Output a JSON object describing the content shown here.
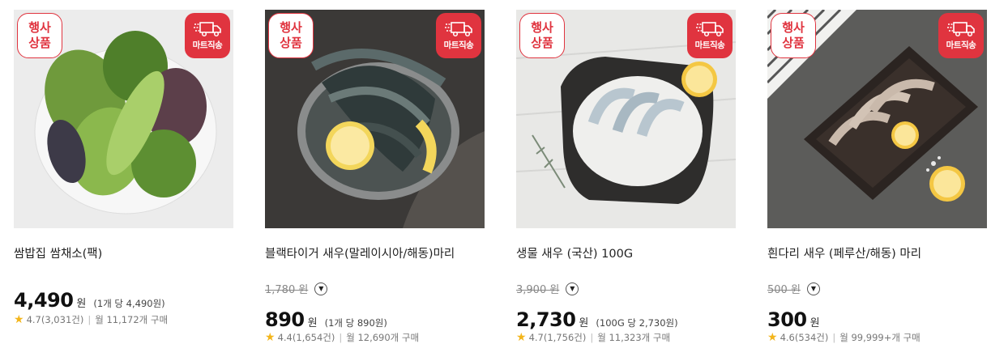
{
  "badges": {
    "sale_line1": "행사",
    "sale_line2": "상품",
    "mart": "마트직송"
  },
  "products": [
    {
      "name": "쌈밥집 쌈채소(팩)",
      "old_price": "",
      "price": "4,490",
      "won": "원",
      "unit_price": "(1개 당 4,490원)",
      "rating": "4.7(3,031건)",
      "sold": "월 11,172개 구매",
      "image": "leafy-greens-icon"
    },
    {
      "name": "블랙타이거 새우(말레이시아/해동)마리",
      "old_price": "1,780 원",
      "price": "890",
      "won": "원",
      "unit_price": "(1개 당 890원)",
      "rating": "4.4(1,654건)",
      "sold": "월 12,690개 구매",
      "image": "black-tiger-shrimp-icon"
    },
    {
      "name": "생물 새우 (국산) 100G",
      "old_price": "3,900 원",
      "price": "2,730",
      "won": "원",
      "unit_price": "(100G 당 2,730원)",
      "rating": "4.7(1,756건)",
      "sold": "월 11,323개 구매",
      "image": "fresh-shrimp-icon"
    },
    {
      "name": "흰다리 새우 (페루산/해동) 마리",
      "old_price": "500 원",
      "price": "300",
      "won": "원",
      "unit_price": "",
      "rating": "4.6(534건)",
      "sold": "월 99,999+개 구매",
      "image": "whiteleg-shrimp-icon"
    }
  ]
}
